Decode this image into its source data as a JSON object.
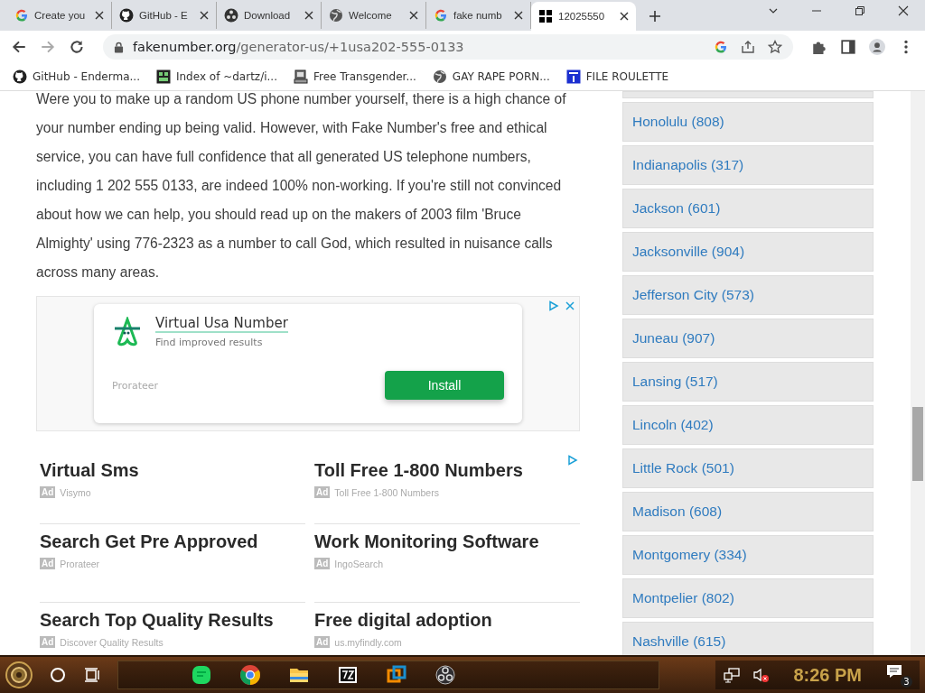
{
  "browser": {
    "tabs": [
      {
        "title": "Create you",
        "kind": "google",
        "selected": false
      },
      {
        "title": "GitHub - E",
        "kind": "github",
        "selected": false
      },
      {
        "title": "Download",
        "kind": "obs",
        "selected": false
      },
      {
        "title": "Welcome",
        "kind": "globe",
        "selected": false
      },
      {
        "title": "fake numb",
        "kind": "google",
        "selected": false
      },
      {
        "title": "12025550",
        "kind": "grid",
        "selected": true
      }
    ],
    "address": {
      "domain": "fakenumber.org",
      "path": "/generator-us/+1usa202-555-0133"
    },
    "bookmarks": [
      {
        "label": "GitHub - Enderma...",
        "kind": "github"
      },
      {
        "label": "Index of ~dartz/i...",
        "kind": "grid"
      },
      {
        "label": "Free Transgender...",
        "kind": "computer"
      },
      {
        "label": "GAY RAPE PORN...",
        "kind": "globe"
      },
      {
        "label": "FILE ROULETTE",
        "kind": "mft"
      }
    ]
  },
  "article": {
    "paragraph": "Were you to make up a random US phone number yourself, there is a high chance of your number ending up being valid. However, with Fake Number's free and ethical service, you can have full confidence that all generated US telephone numbers, including 1 202 555 0133, are indeed 100% non-working. If you're still not convinced about how we can help, you should read up on the makers of 2003 film 'Bruce Almighty' using 776-2323 as a number to call God, which resulted in nuisance calls across many areas."
  },
  "ad_banner": {
    "title": "Virtual Usa Number",
    "subtitle": "Find improved results",
    "advertiser": "Prorateer",
    "button": "Install"
  },
  "text_ads": [
    {
      "title": "Virtual Sms",
      "badge": "Ad",
      "source": "Visymo"
    },
    {
      "title": "Toll Free 1-800 Numbers",
      "badge": "Ad",
      "source": "Toll Free 1-800 Numbers"
    },
    {
      "title": "Search Get Pre Approved",
      "badge": "Ad",
      "source": "Prorateer"
    },
    {
      "title": "Work Monitoring Software",
      "badge": "Ad",
      "source": "IngoSearch"
    },
    {
      "title": "Search Top Quality Results",
      "badge": "Ad",
      "source": "Discover Quality Results"
    },
    {
      "title": "Free digital adoption",
      "badge": "Ad",
      "source": "us.myfindly.com"
    }
  ],
  "cities": [
    "Honolulu (808)",
    "Indianapolis (317)",
    "Jackson (601)",
    "Jacksonville (904)",
    "Jefferson City (573)",
    "Juneau (907)",
    "Lansing (517)",
    "Lincoln (402)",
    "Little Rock (501)",
    "Madison (608)",
    "Montgomery (334)",
    "Montpelier (802)",
    "Nashville (615)"
  ],
  "taskbar": {
    "clock": "8:26 PM",
    "notification_count": "3"
  }
}
